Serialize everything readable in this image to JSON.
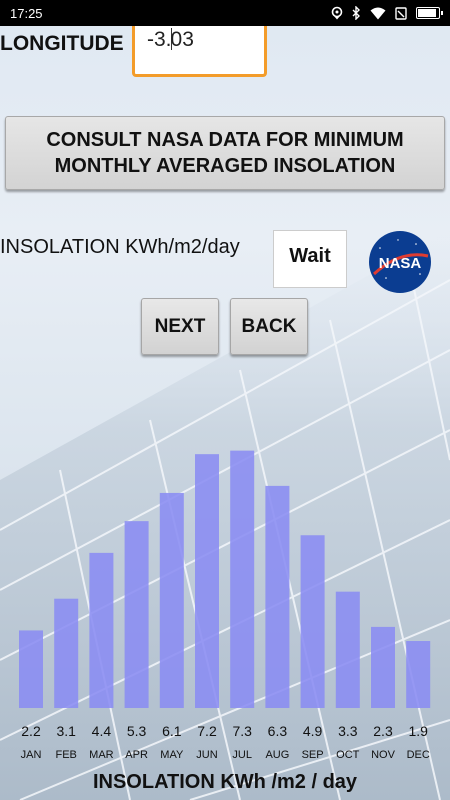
{
  "status_bar": {
    "time": "17:25"
  },
  "form": {
    "longitude_label": "LONGITUDE",
    "longitude_value_before_caret": "-3.",
    "longitude_value_after_caret": "03",
    "consult_button_label": "CONSULT NASA DATA FOR MINIMUM MONTHLY AVERAGED INSOLATION",
    "insolation_label": "INSOLATION KWh/m2/day",
    "insolation_value": "Wait",
    "nasa_logo_text": "NASA",
    "next_label": "NEXT",
    "back_label": "BACK"
  },
  "colors": {
    "accent_orange": "#f39c2a",
    "bar_fill": "#8a8cf2",
    "nasa_blue": "#0b3d91"
  },
  "chart_data": {
    "type": "bar",
    "title": "INSOLATION KWh /m2 / day",
    "categories": [
      "JAN",
      "FEB",
      "MAR",
      "APR",
      "MAY",
      "JUN",
      "JUL",
      "AUG",
      "SEP",
      "OCT",
      "NOV",
      "DEC"
    ],
    "values": [
      2.2,
      3.1,
      4.4,
      5.3,
      6.1,
      7.2,
      7.3,
      6.3,
      4.9,
      3.3,
      2.3,
      1.9
    ],
    "value_labels": [
      "2.2",
      "3.1",
      "4.4",
      "5.3",
      "6.1",
      "7.2",
      "7.3",
      "6.3",
      "4.9",
      "3.3",
      "2.3",
      "1.9"
    ],
    "ylim": [
      0,
      7.8
    ],
    "grid": false
  }
}
